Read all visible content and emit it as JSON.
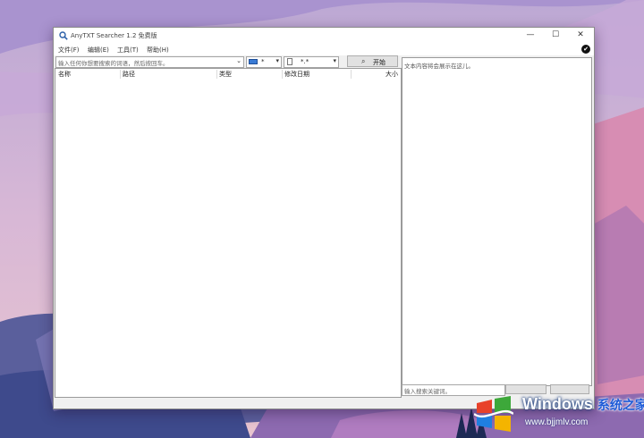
{
  "window": {
    "title": "AnyTXT Searcher 1.2 免费版",
    "controls": {
      "minimize": "—",
      "maximize": "☐",
      "close": "✕"
    }
  },
  "menu": {
    "items": [
      "文件(F)",
      "编辑(E)",
      "工具(T)",
      "帮助(H)"
    ]
  },
  "toolbar": {
    "search_placeholder": "输入任何你想要搜索的词语，然后按回车。",
    "drive_value": "*",
    "type_value": "*.*",
    "start_label": "开始"
  },
  "results": {
    "columns": [
      "名称",
      "路径",
      "类型",
      "修改日期",
      "大小"
    ]
  },
  "preview": {
    "placeholder": "文本内容将会展示在这儿。",
    "keyword_placeholder": "输入搜索关键词。"
  },
  "watermark": {
    "brand": "Windows",
    "brand_cn": "系统之家",
    "url": "www.bjjmlv.com"
  },
  "colors": {
    "drive_icon": "#3a7bd5",
    "watermark_blue": "#1d5bd8"
  }
}
